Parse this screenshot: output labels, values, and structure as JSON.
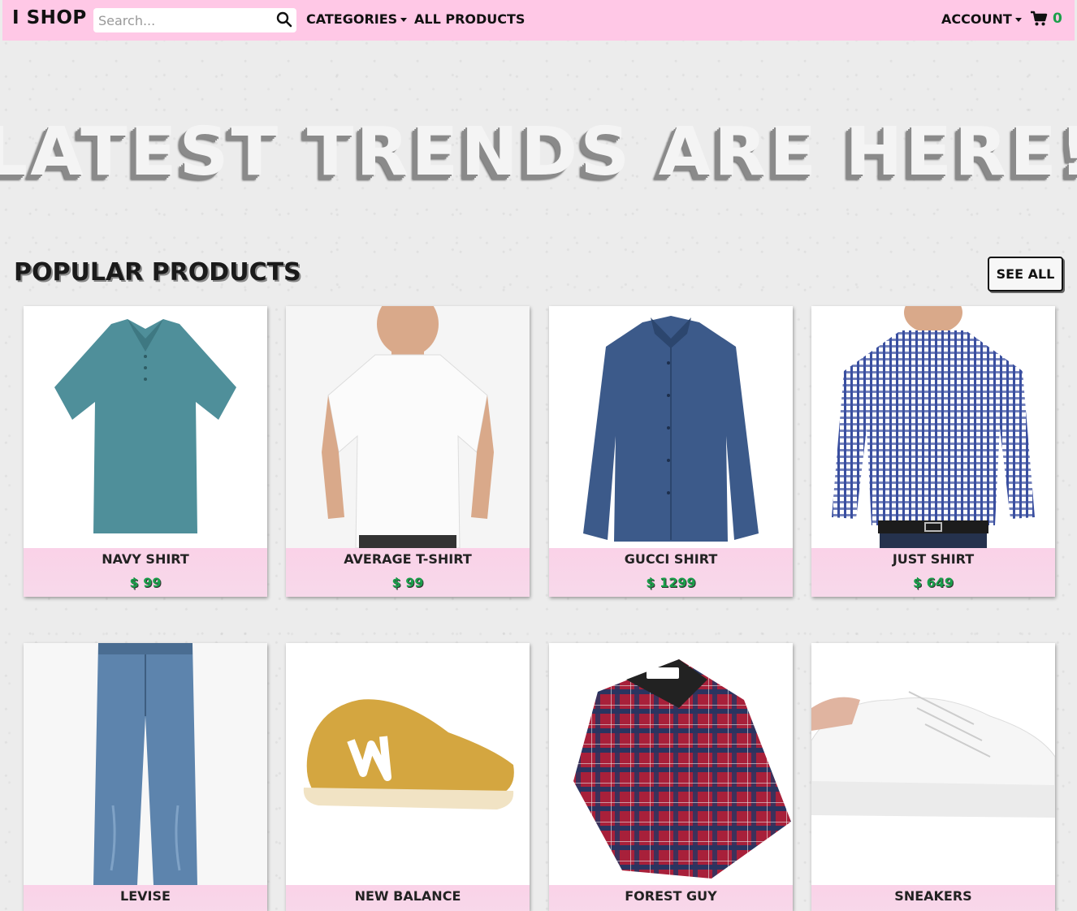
{
  "nav": {
    "brand": "I SHOP",
    "search_placeholder": "Search...",
    "categories": "CATEGORIES",
    "all_products": "ALL PRODUCTS",
    "account": "ACCOUNT",
    "cart_count": "0"
  },
  "hero": {
    "title": "LATEST TRENDS ARE HERE!"
  },
  "popular": {
    "title": "POPULAR PRODUCTS",
    "see_all": "SEE ALL",
    "products": [
      {
        "name": "NAVY SHIRT",
        "price": "$ 99",
        "image": "teal-polo-shirt"
      },
      {
        "name": "AVERAGE T-SHIRT",
        "price": "$ 99",
        "image": "white-tshirt"
      },
      {
        "name": "GUCCI SHIRT",
        "price": "$ 1299",
        "image": "denim-button-shirt"
      },
      {
        "name": "JUST SHIRT",
        "price": "$ 649",
        "image": "checked-shirt"
      },
      {
        "name": "LEVISE",
        "price": "",
        "image": "blue-jeans"
      },
      {
        "name": "NEW BALANCE",
        "price": "",
        "image": "yellow-sneaker"
      },
      {
        "name": "FOREST GUY",
        "price": "",
        "image": "plaid-shirt"
      },
      {
        "name": "SNEAKERS",
        "price": "",
        "image": "white-sneaker"
      }
    ]
  },
  "colors": {
    "nav_bg": "#ffc8e6",
    "price_green": "#1a9f4a",
    "card_info_bg": "#fad2e8"
  }
}
